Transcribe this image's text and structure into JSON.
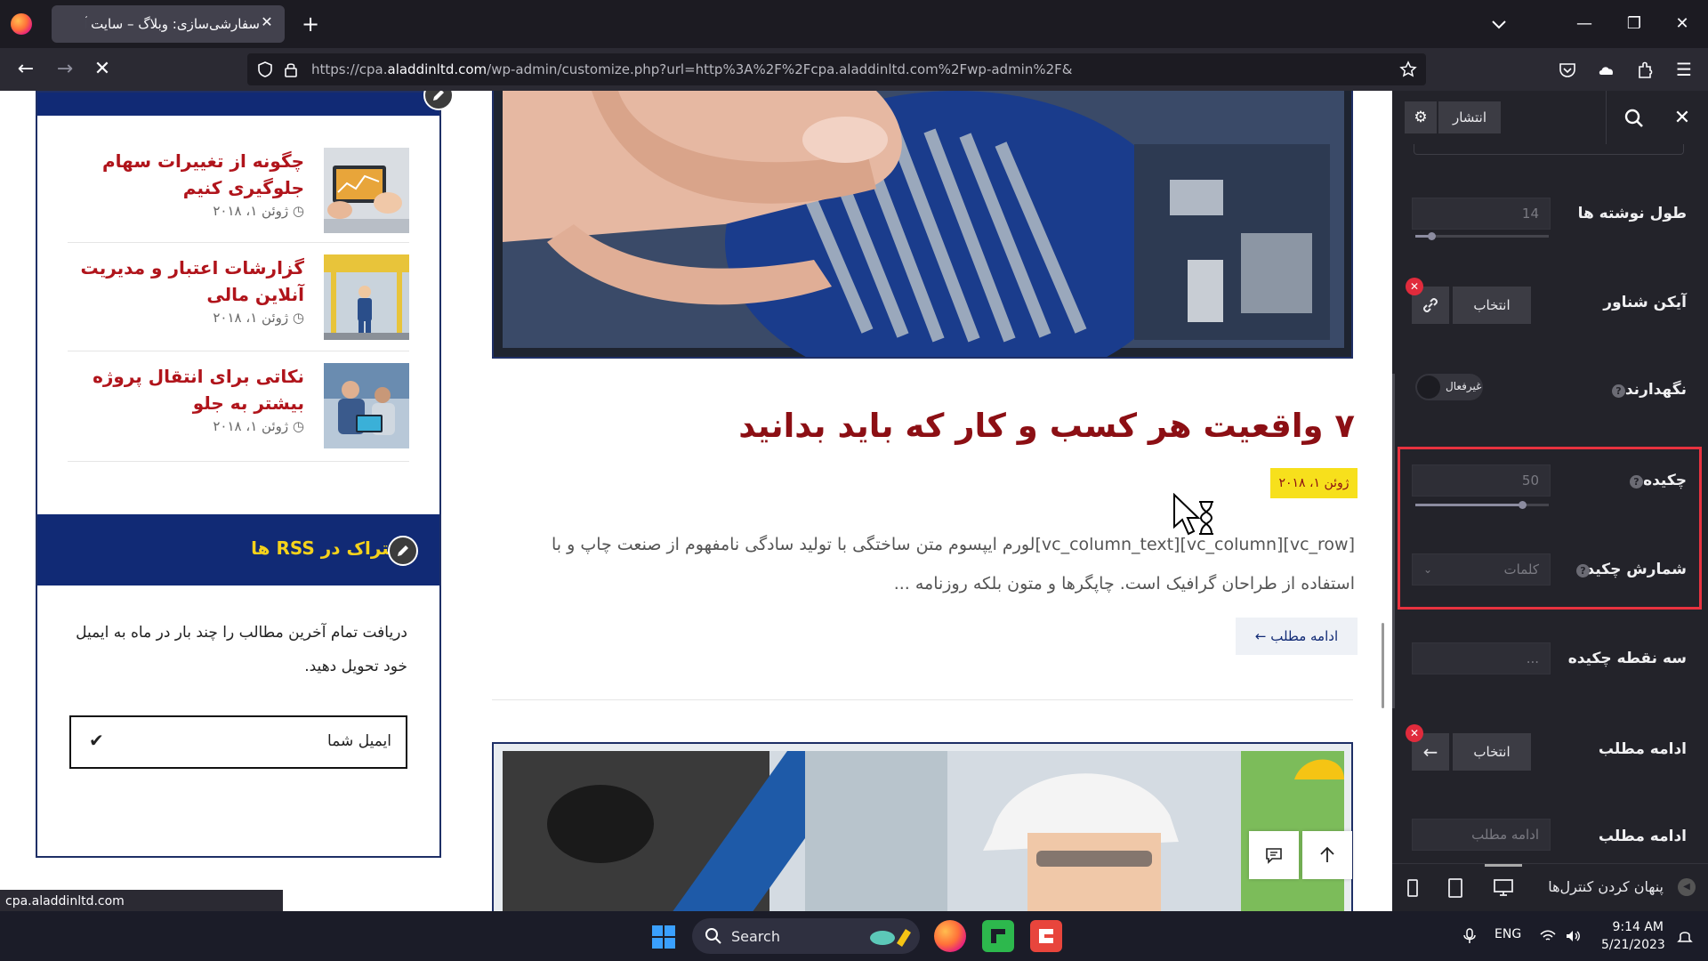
{
  "browser": {
    "tab_title": "سفارشی‌سازی: وبلاگ – سایت آزمایشی",
    "tab_close": "✕",
    "new_tab": "+",
    "url_prefix": "https://cpa.",
    "url_domain": "aladdinltd.com",
    "url_rest": "/wp-admin/customize.php?url=http%3A%2F%2Fcpa.aladdinltd.com%2Fwp-admin%2F&",
    "status_link": "cpa.aladdinltd.com"
  },
  "sidebar": {
    "posts": [
      {
        "title": "چگونه از تغییرات سهام جلوگیری کنیم",
        "date": "ژوئن ۱، ۲۰۱۸"
      },
      {
        "title": "گزارشات اعتبار و مدیریت آنلاین مالی",
        "date": "ژوئن ۱، ۲۰۱۸"
      },
      {
        "title": "نکاتی برای انتقال پروژه بیشتر به جلو",
        "date": "ژوئن ۱، ۲۰۱۸"
      }
    ],
    "rss_title": "اشتراک در RSS ها",
    "rss_desc": "دریافت تمام آخرین مطالب را چند بار در ماه به ایمیل خود تحویل دهید.",
    "email_placeholder": "ایمیل شما"
  },
  "article": {
    "title": "۷ واقعیت هر کسب و کار که باید بدانید",
    "date": "ژوئن ۱، ۲۰۱۸",
    "excerpt": "[vc_row][vc_column][vc_column_text]لورم ایپسوم متن ساختگی با تولید سادگی نامفهوم از صنعت چاپ و با استفاده از طراحان گرافیک است. چاپگرها و متون بلکه روزنامه ...",
    "read_more": "ادامه مطلب ←"
  },
  "customizer": {
    "publish": "انتشار",
    "close": "✕",
    "excerpt_length_label": "طول نوشته ها",
    "excerpt_length_value": "14",
    "excerpt_length_fraction": 0.12,
    "float_icon_label": "آیکن شناور",
    "pick_label": "انتخاب",
    "sticky_label": "نگهدارنده",
    "sticky_toggle": "غیرفعال",
    "excerpt_label": "چکیده",
    "excerpt_value": "50",
    "excerpt_fraction": 0.8,
    "excerpt_count_label": "شمارش چکیده",
    "excerpt_count_value": "کلمات",
    "ellipsis_label": "سه نقطه چکیده",
    "ellipsis_value": "...",
    "read_more_label": "ادامه مطلب",
    "read_more_label2": "ادامه مطلب",
    "read_more_placeholder": "ادامه مطلب",
    "hide_controls": "پنهان کردن کنترل‌ها"
  },
  "taskbar": {
    "search": "Search",
    "lang": "ENG",
    "time": "9:14 AM",
    "date": "5/21/2023"
  },
  "colors": {
    "brand_navy": "#112a75",
    "title_red": "#8c0f14",
    "date_yellow": "#f7e01c",
    "highlight_red": "#e8323f"
  }
}
